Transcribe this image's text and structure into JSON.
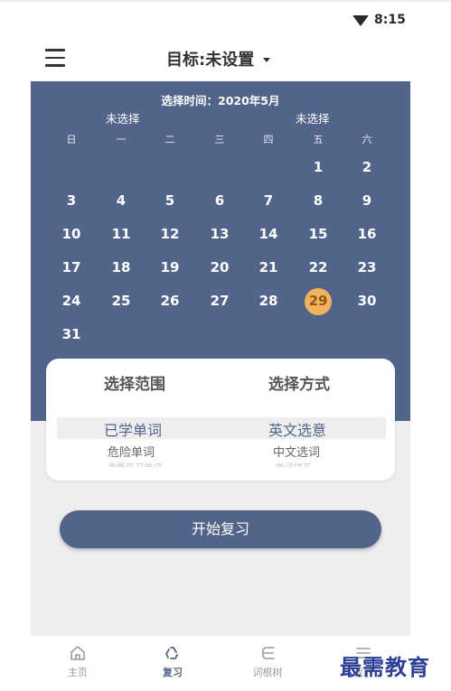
{
  "status_bar": {
    "time": "8:15"
  },
  "header": {
    "title": "目标:未设置"
  },
  "calendar": {
    "selected_time": "选择时间：2020年5月",
    "left_marker": "未选择",
    "right_marker": "未选择",
    "weekdays": [
      "日",
      "一",
      "二",
      "三",
      "四",
      "五",
      "六"
    ],
    "days": [
      "1",
      "2",
      "3",
      "4",
      "5",
      "6",
      "7",
      "8",
      "9",
      "10",
      "11",
      "12",
      "13",
      "14",
      "15",
      "16",
      "17",
      "18",
      "19",
      "20",
      "21",
      "22",
      "23",
      "24",
      "25",
      "26",
      "27",
      "28",
      "29",
      "30",
      "31"
    ],
    "selected_day": "29",
    "selected_color": "#f4b25c"
  },
  "picker": {
    "range_title": "选择范围",
    "mode_title": "选择方式",
    "range_selected": "已学单词",
    "range_next": "危险单词",
    "range_faded": "需要复习单词",
    "mode_selected": "英文选意",
    "mode_next": "中文选词",
    "mode_faded": "单词拼写"
  },
  "start_button": {
    "label": "开始复习"
  },
  "bottom_nav": {
    "items": [
      {
        "label": "主页",
        "icon": "home-icon"
      },
      {
        "label": "复习",
        "icon": "recycle-icon"
      },
      {
        "label": "词根树",
        "icon": "tree-icon"
      },
      {
        "label": "我的",
        "icon": "list-icon"
      }
    ],
    "active_color": "#52648a"
  },
  "watermark": "最需教育",
  "colors": {
    "primary": "#52648a",
    "background": "#eeeeee",
    "accent": "#f4b25c"
  }
}
